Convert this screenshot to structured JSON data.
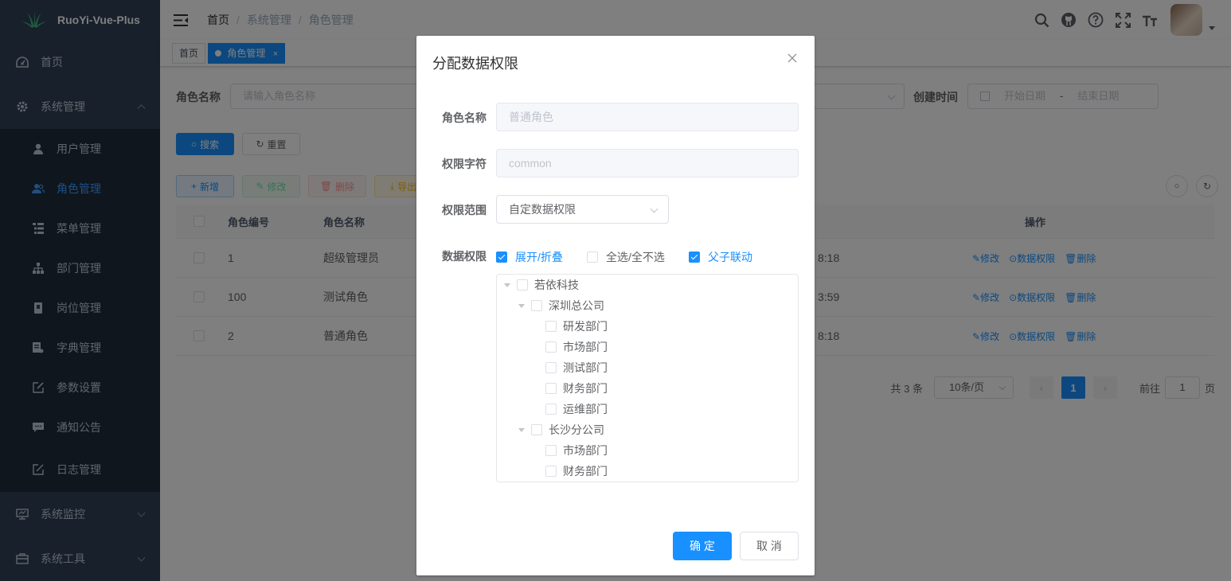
{
  "app": {
    "title": "RuoYi-Vue-Plus"
  },
  "sidebar": {
    "items": [
      {
        "label": "首页"
      },
      {
        "label": "系统管理"
      },
      {
        "label": "系统监控"
      },
      {
        "label": "系统工具"
      }
    ],
    "sub_items": [
      {
        "label": "用户管理"
      },
      {
        "label": "角色管理"
      },
      {
        "label": "菜单管理"
      },
      {
        "label": "部门管理"
      },
      {
        "label": "岗位管理"
      },
      {
        "label": "字典管理"
      },
      {
        "label": "参数设置"
      },
      {
        "label": "通知公告"
      },
      {
        "label": "日志管理"
      }
    ]
  },
  "breadcrumb": [
    "首页",
    "系统管理",
    "角色管理"
  ],
  "tags": [
    {
      "label": "首页"
    },
    {
      "label": "角色管理"
    }
  ],
  "search": {
    "role_name_label": "角色名称",
    "role_name_placeholder": "请输入角色名称",
    "created_label": "创建时间",
    "start_placeholder": "开始日期",
    "date_sep": "-",
    "end_placeholder": "结束日期",
    "search_btn": "搜索",
    "reset_btn": "重置"
  },
  "toolbar": {
    "add": "新增",
    "edit": "修改",
    "delete": "删除",
    "export": "导出"
  },
  "table": {
    "headers": {
      "id": "角色编号",
      "name": "角色名称",
      "ops": "操作"
    },
    "rows": [
      {
        "id": "1",
        "name": "超级管理员",
        "time": "8:18"
      },
      {
        "id": "100",
        "name": "测试角色",
        "time": "3:59"
      },
      {
        "id": "2",
        "name": "普通角色",
        "time": "8:18"
      }
    ],
    "op_edit": "修改",
    "op_data": "数据权限",
    "op_delete": "删除"
  },
  "pager": {
    "total": "共 3 条",
    "size": "10条/页",
    "current": "1",
    "goto": "前往",
    "goto_value": "1",
    "page_unit": "页"
  },
  "dialog": {
    "title": "分配数据权限",
    "role_name_label": "角色名称",
    "role_name_value": "普通角色",
    "perm_key_label": "权限字符",
    "perm_key_value": "common",
    "scope_label": "权限范围",
    "scope_value": "自定数据权限",
    "data_label": "数据权限",
    "expand_label": "展开/折叠",
    "select_all_label": "全选/全不选",
    "linkage_label": "父子联动",
    "tree": [
      {
        "label": "若依科技"
      },
      {
        "label": "深圳总公司"
      },
      {
        "label": "研发部门"
      },
      {
        "label": "市场部门"
      },
      {
        "label": "测试部门"
      },
      {
        "label": "财务部门"
      },
      {
        "label": "运维部门"
      },
      {
        "label": "长沙分公司"
      },
      {
        "label": "市场部门"
      },
      {
        "label": "财务部门"
      }
    ],
    "ok_btn": "确 定",
    "cancel_btn": "取 消"
  },
  "colors": {
    "primary": "#1890ff",
    "sidebar_bg": "#304156",
    "submenu_bg": "#1f2d3d"
  }
}
